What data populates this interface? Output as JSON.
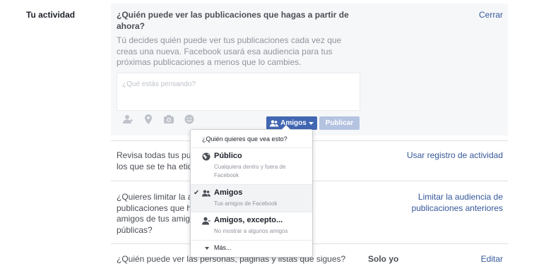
{
  "section": {
    "label": "Tu actividad"
  },
  "expanded": {
    "question": "¿Quién puede ver las publicaciones que hagas a partir de ahora?",
    "close_label": "Cerrar",
    "description": "Tú decides quién puede ver tus publicaciones cada vez que creas una nueva. Facebook usará esa audiencia para tus próximas publicaciones a menos que lo cambies.",
    "composer": {
      "placeholder": "¿Qué estás pensando?",
      "audience_label": "Amigos",
      "publish_label": "Publicar",
      "icons": [
        "tag-people-icon",
        "location-icon",
        "camera-icon",
        "feeling-icon"
      ]
    }
  },
  "rows": [
    {
      "text": "Revisa todas tus publi\nlos que se te ha etique",
      "link": "Usar registro de actividad"
    },
    {
      "text": "¿Quieres limitar la aud\npublicaciones que has\namigos de tus amigos\npúblicas?",
      "link": "Limitar la audiencia de\npublicaciones anteriores"
    },
    {
      "text": "¿Quién puede ver las personas, páginas y listas que sigues?",
      "value": "Solo yo",
      "link": "Editar"
    }
  ],
  "dropdown": {
    "header": "¿Quién quieres que vea esto?",
    "items": [
      {
        "title": "Público",
        "subtitle": "Cualquiera dentro y fuera de Facebook",
        "icon": "globe-icon",
        "selected": false
      },
      {
        "title": "Amigos",
        "subtitle": "Tus amigos de Facebook",
        "icon": "friends-icon",
        "selected": true
      },
      {
        "title": "Amigos, excepto...",
        "subtitle": "No mostrar a algunos amigos",
        "icon": "friend-except-icon",
        "selected": false
      }
    ],
    "more_label": "Más...",
    "check_glyph": "✔"
  },
  "colors": {
    "link": "#365899",
    "primary_button": "#4267b2",
    "disabled_button": "#b4c3e0",
    "panel_bg": "#f6f7f9"
  }
}
